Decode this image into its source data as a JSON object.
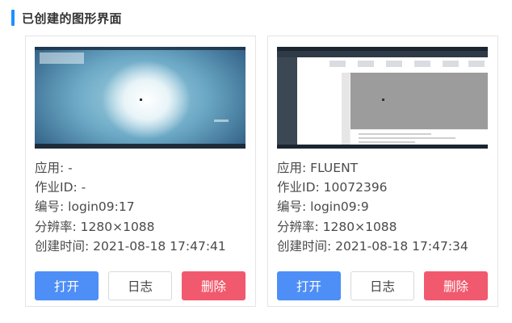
{
  "section": {
    "title": "已创建的图形界面"
  },
  "colors": {
    "accent": "#1e90ff",
    "open": "#4e8ef7",
    "delete": "#f15a6e"
  },
  "cards": [
    {
      "thumbnail": "blurred-blue-desktop-screenshot",
      "lines": [
        "应用: -",
        "作业ID: -",
        "编号: login09:17",
        "分辨率: 1280×1088",
        "创建时间: 2021-08-18 17:47:41"
      ],
      "buttons": {
        "open": "打开",
        "log": "日志",
        "delete": "删除"
      }
    },
    {
      "thumbnail": "fluent-application-desktop-screenshot",
      "lines": [
        "应用: FLUENT",
        "作业ID: 10072396",
        "编号: login09:9",
        "分辨率: 1280×1088",
        "创建时间: 2021-08-18 17:47:34"
      ],
      "buttons": {
        "open": "打开",
        "log": "日志",
        "delete": "删除"
      }
    }
  ]
}
